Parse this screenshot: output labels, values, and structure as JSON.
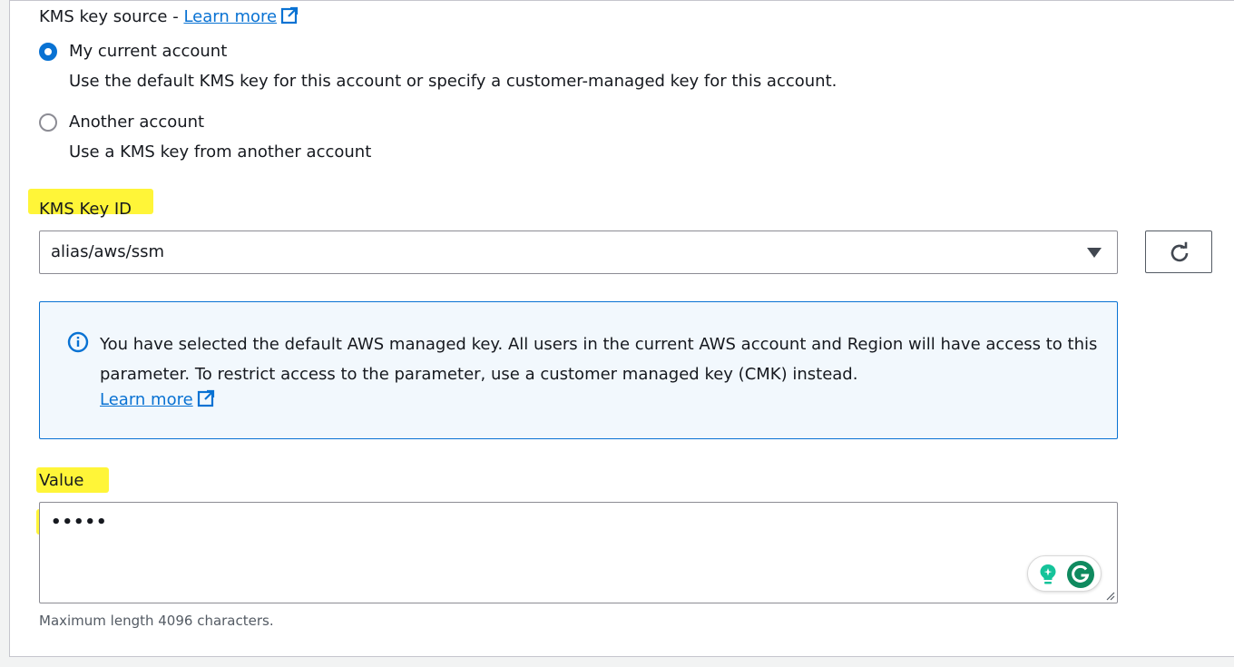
{
  "kms_source": {
    "label": "KMS key source - ",
    "learn_more": "Learn more",
    "options": [
      {
        "label": "My current account",
        "description": "Use the default KMS key for this account or specify a customer-managed key for this account.",
        "selected": true
      },
      {
        "label": "Another account",
        "description": "Use a KMS key from another account",
        "selected": false
      }
    ]
  },
  "kms_key": {
    "label": "KMS Key ID",
    "value": "alias/aws/ssm"
  },
  "alert": {
    "text": "You have selected the default AWS managed key. All users in the current AWS account and Region will have access to this parameter. To restrict access to the parameter, use a customer managed key (CMK) instead.",
    "learn_more": "Learn more"
  },
  "value_field": {
    "label": "Value",
    "value": "•••••",
    "hint": "Maximum length 4096 characters."
  },
  "colors": {
    "link": "#0972d3",
    "highlight": "#fff200",
    "alert_bg": "#f2f8fd",
    "grammarly_green": "#15c39a"
  },
  "icons": {
    "external_link": "external-link-icon",
    "refresh": "refresh-icon",
    "info": "info-icon",
    "caret": "caret-down-icon",
    "grammarly": "grammarly-icon"
  }
}
